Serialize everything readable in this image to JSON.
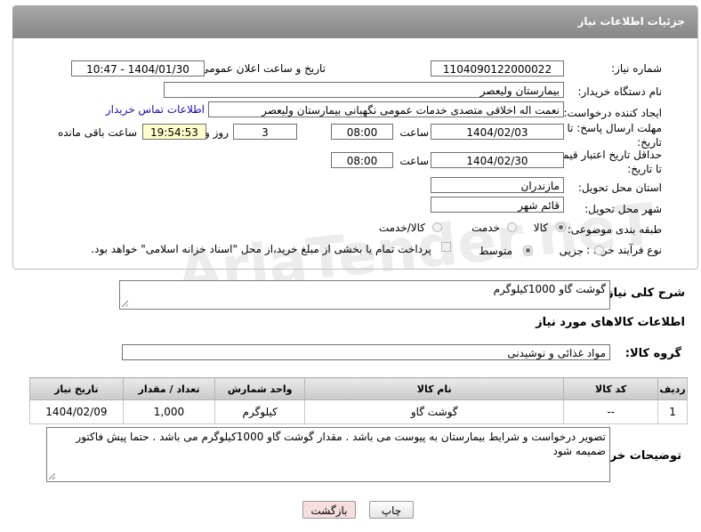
{
  "header": {
    "title": "جزئیات اطلاعات نیاز"
  },
  "fields": {
    "need_number_label": "شماره نیاز:",
    "need_number": "1104090122000022",
    "announce_label": "تاریخ و ساعت اعلان عمومی:",
    "announce_value": "1404/01/30 - 10:47",
    "buyer_org_label": "نام دستگاه خریدار:",
    "buyer_org": "بیمارستان ولیعصر",
    "requester_label": "ایجاد کننده درخواست:",
    "requester": "نعمت اله اخلاقی متصدی خدمات عمومی نگهبانی بیمارستان ولیعصر",
    "contact_link": "اطلاعات تماس خریدار",
    "deadline_label": "مهلت ارسال پاسخ: تا تاریخ:",
    "deadline_date": "1404/02/03",
    "time_label": "ساعت",
    "deadline_time": "08:00",
    "days_value": "3",
    "days_label": "روز و",
    "remaining_time": "19:54:53",
    "remaining_label": "ساعت باقی مانده",
    "price_valid_label": "حداقل تاریخ اعتبار قیمت: تا تاریخ:",
    "price_valid_date": "1404/02/30",
    "price_valid_time": "08:00",
    "province_label": "استان محل تحویل:",
    "province": "مازندران",
    "city_label": "شهر محل تحویل:",
    "city": "قائم شهر",
    "category_label": "طبقه بندی موضوعی:",
    "category_options": [
      "کالا",
      "خدمت",
      "کالا/خدمت"
    ],
    "process_label": "نوع فرآیند خرید :",
    "process_options": [
      "جزیی",
      "متوسط"
    ],
    "payment_note": "پرداخت تمام یا بخشی از مبلغ خرید،از محل \"اسناد خزانه اسلامی\" خواهد بود."
  },
  "summary": {
    "label": "شرح کلی نیاز:",
    "value": "گوشت گاو 1000کیلوگرم"
  },
  "goods_section_title": "اطلاعات کالاهای مورد نیاز",
  "goods_group": {
    "label": "گروه کالا:",
    "value": "مواد غذائی و نوشیدنی"
  },
  "table": {
    "headers": [
      "ردیف",
      "کد کالا",
      "نام کالا",
      "واحد شمارش",
      "تعداد / مقدار",
      "تاریخ نیاز"
    ],
    "rows": [
      [
        "1",
        "--",
        "گوشت گاو",
        "کیلوگرم",
        "1,000",
        "1404/02/09"
      ]
    ]
  },
  "buyer_notes": {
    "label": "توضیحات خریدار:",
    "value": "تصویر درخواست و شرایط بیمارستان به پیوست می باشد . مقدار گوشت گاو 1000کیلوگرم می باشد . حتما پیش فاکتور ضمیمه شود"
  },
  "buttons": {
    "print": "چاپ",
    "back": "بازگشت"
  },
  "watermark": "AriaTender.neT",
  "colors": {
    "header_bg": "#999999",
    "link": "#1a0dab",
    "back_button_bg": "#f6dede"
  }
}
